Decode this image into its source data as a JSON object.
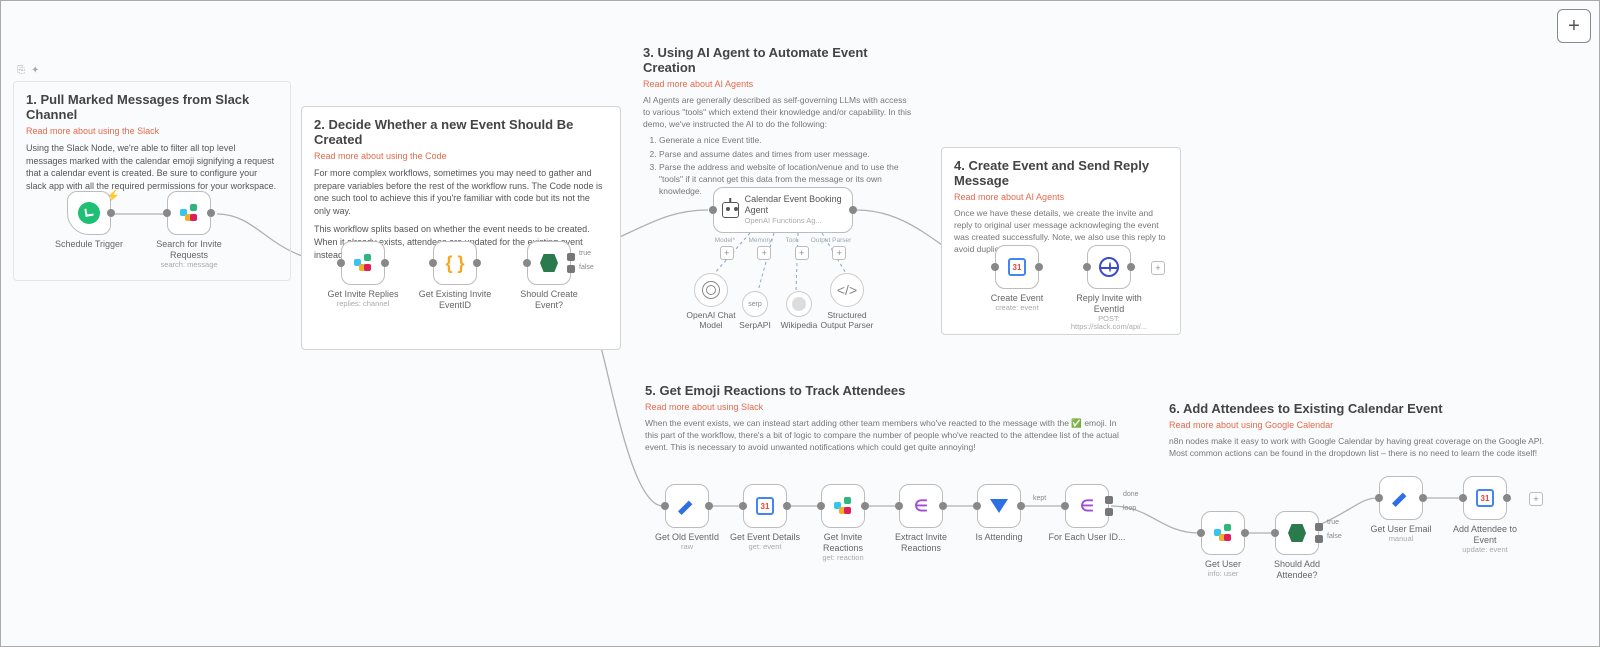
{
  "sections": {
    "s1": {
      "title": "1. Pull Marked Messages from Slack Channel",
      "link": "Read more about using the Slack",
      "desc": "Using the Slack Node, we're able to filter all top level messages marked with the calendar emoji signifying a request that a calendar event is created. Be sure to configure your slack app with all the required permissions for your workspace."
    },
    "s2": {
      "title": "2. Decide Whether a new Event Should Be Created",
      "link": "Read more about using the Code",
      "desc": "For more complex workflows, sometimes you may need to gather and prepare variables before the rest of the workflow runs. The Code node is one such tool to achieve this if you're familiar with code but its not the only way.",
      "desc2": "This workflow splits based on whether the event needs to be created. When it already exists, attendees are updated for the existing event instead."
    },
    "s3": {
      "title": "3. Using AI Agent to Automate Event Creation",
      "link": "Read more about AI Agents",
      "desc": "AI Agents are generally described as self-governing LLMs with access to various \"tools\" which extend their knowledge and/or capability. In this demo, we've instructed the AI to do the following:",
      "li1": "Generate a nice Event title.",
      "li2": "Parse and assume dates and times from user message.",
      "li3": "Parse the address and website of location/venue and to use the \"tools\" if it cannot get this data from the message or its own knowledge."
    },
    "s4": {
      "title": "4. Create Event and Send Reply Message",
      "link": "Read more about AI Agents",
      "desc": "Once we have these details, we create the invite and reply to original user message acknowleging the event was created successfully. Note, we also use this reply to avoid duplicates!"
    },
    "s5": {
      "title": "5. Get Emoji Reactions to Track Attendees",
      "link": "Read more about using Slack",
      "desc": "When the event exists, we can instead start adding other team members who've reacted to the message with the ✅ emoji. In this part of the workflow, there's a bit of logic to compare the number of people who've reacted to the attendee list of the actual event. This is necessary to avoid unwanted notifications which could get quite annoying!"
    },
    "s6": {
      "title": "6. Add Attendees to Existing Calendar Event",
      "link": "Read more about using Google Calendar",
      "desc": "n8n nodes make it easy to work with Google Calendar by having great coverage on the Google API. Most common actions can be found in the dropdown list – there is no need to learn the code itself!"
    }
  },
  "nodes": {
    "schedule": {
      "label": "Schedule Trigger",
      "sub": ""
    },
    "search": {
      "label": "Search for Invite Requests",
      "sub": "search: message"
    },
    "getReplies": {
      "label": "Get Invite Replies",
      "sub": "replies: channel"
    },
    "getExisting": {
      "label": "Get Existing Invite EventID",
      "sub": ""
    },
    "shouldCreate": {
      "label": "Should Create Event?",
      "sub": ""
    },
    "agent": {
      "label": "Calendar Event Booking Agent",
      "sub": "OpenAI Functions Ag..."
    },
    "openai": {
      "label": "OpenAI Chat Model"
    },
    "serp": {
      "label": "SerpAPI"
    },
    "wiki": {
      "label": "Wikipedia"
    },
    "parser": {
      "label": "Structured Output Parser"
    },
    "createEvent": {
      "label": "Create Event",
      "sub": "create: event"
    },
    "reply": {
      "label": "Reply Invite with EventId",
      "sub": "POST: https://slack.com/api/..."
    },
    "oldEvent": {
      "label": "Get Old EventId",
      "sub": "raw"
    },
    "eventDetails": {
      "label": "Get Event Details",
      "sub": "get: event"
    },
    "inviteReact": {
      "label": "Get Invite Reactions",
      "sub": "get: reaction"
    },
    "extract": {
      "label": "Extract Invite Reactions",
      "sub": ""
    },
    "isAttending": {
      "label": "Is Attending",
      "sub": ""
    },
    "forEach": {
      "label": "For Each User ID...",
      "sub": ""
    },
    "getUser": {
      "label": "Get User",
      "sub": "info: user"
    },
    "shouldAdd": {
      "label": "Should Add Attendee?",
      "sub": ""
    },
    "getEmail": {
      "label": "Get User Email",
      "sub": "manual"
    },
    "addAtt": {
      "label": "Add Attendee to Event",
      "sub": "update: event"
    }
  },
  "labels": {
    "true": "true",
    "false": "false",
    "loop": "loop",
    "done": "done",
    "agent_ports": {
      "model": "Model*",
      "memory": "Memory",
      "tool": "Tool",
      "parser": "Output Parser"
    }
  }
}
